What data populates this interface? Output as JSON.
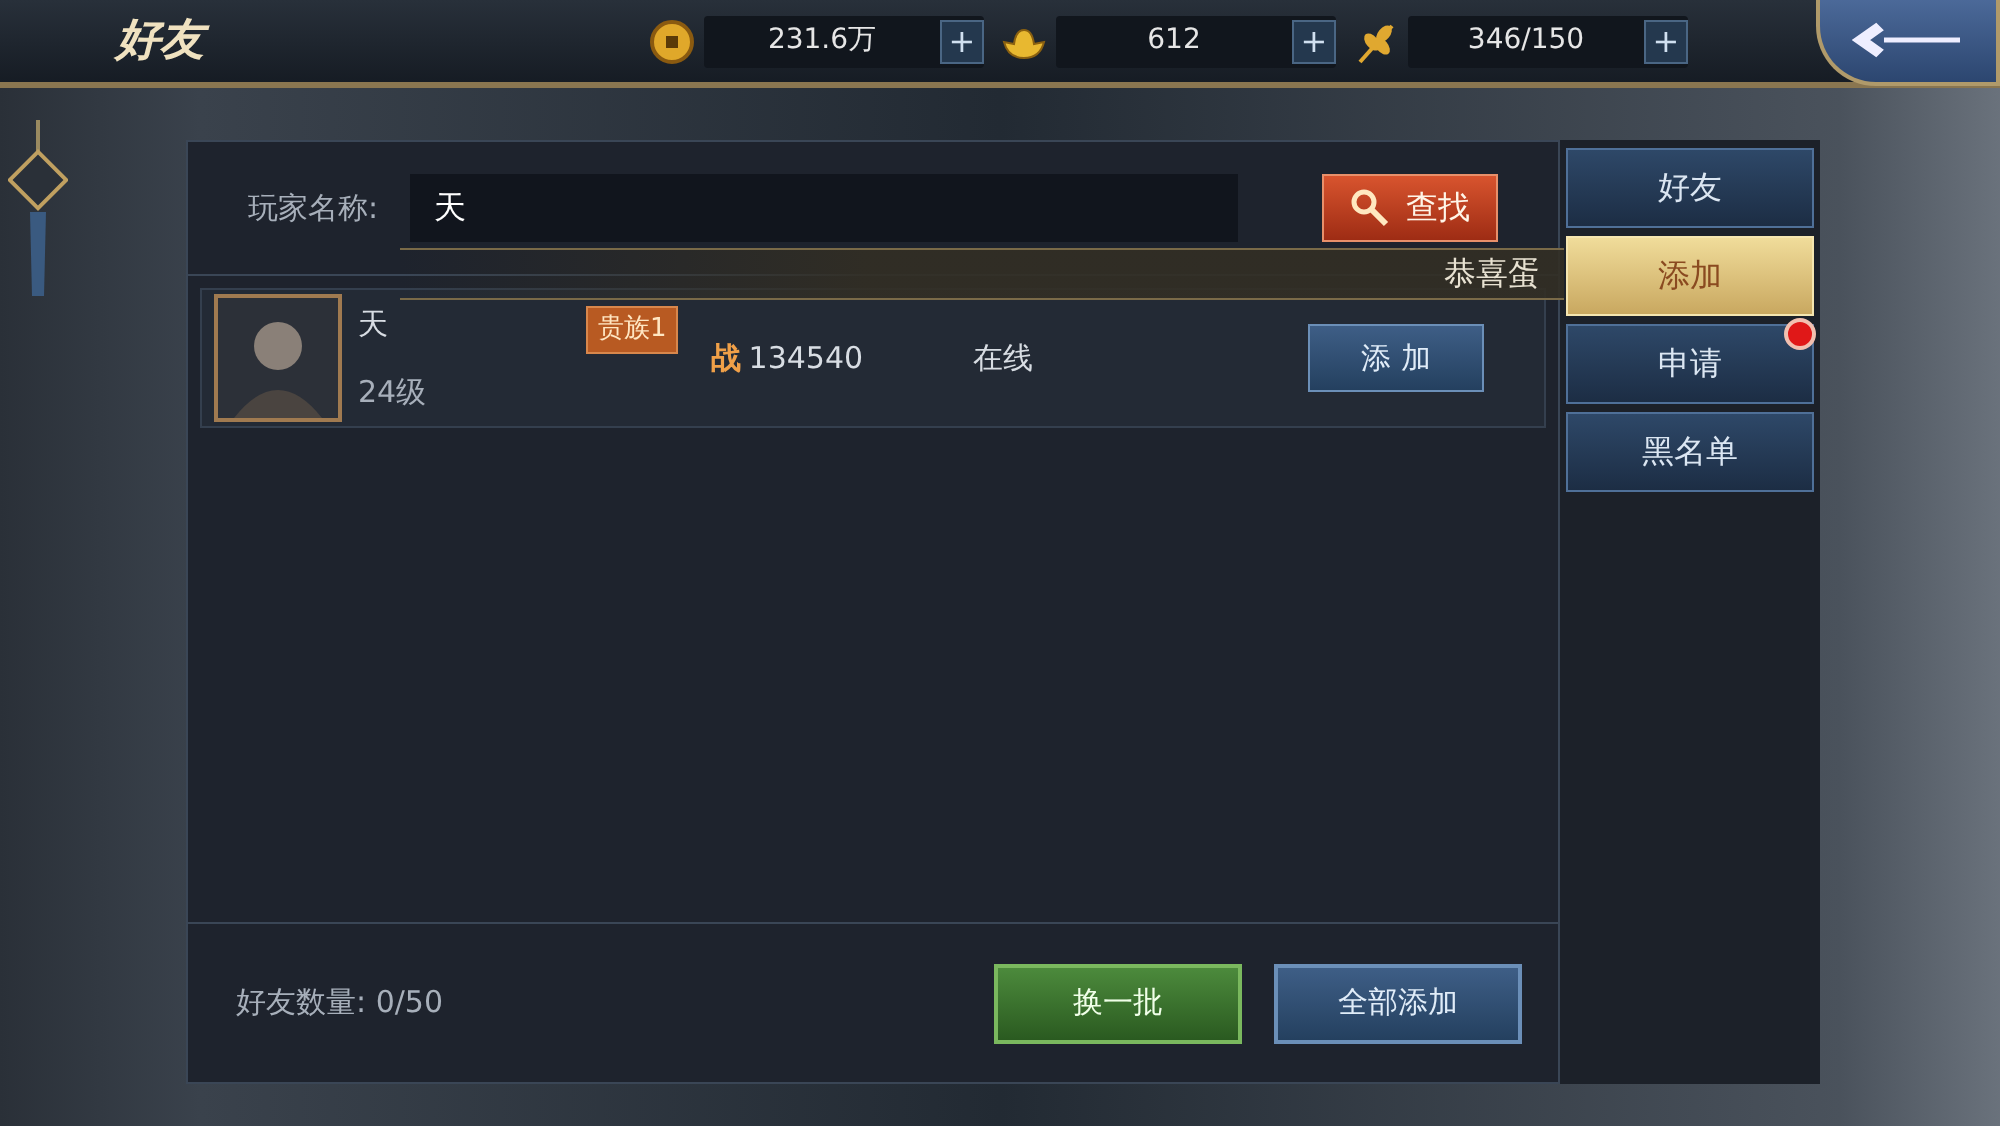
{
  "title": "好友",
  "currencies": [
    {
      "kind": "coin",
      "value": "231.6万",
      "plus": "+"
    },
    {
      "kind": "ingot",
      "value": "612",
      "plus": "+"
    },
    {
      "kind": "grain",
      "value": "346/150",
      "plus": "+"
    }
  ],
  "search": {
    "label": "玩家名称:",
    "value": "天",
    "button": "查找"
  },
  "notice": "恭喜蛋",
  "players": [
    {
      "name": "天",
      "level": "24级",
      "rank": "贵族1",
      "power_mark": "战",
      "power": "134540",
      "status": "在线",
      "action": "添 加"
    }
  ],
  "footer": {
    "count": "好友数量: 0/50",
    "buttons": [
      {
        "label": "换一批",
        "kind": "green"
      },
      {
        "label": "全部添加",
        "kind": "blue"
      }
    ]
  },
  "tabs": [
    {
      "label": "好友",
      "selected": false,
      "badge": false
    },
    {
      "label": "添加",
      "selected": true,
      "badge": false
    },
    {
      "label": "申请",
      "selected": false,
      "badge": true
    },
    {
      "label": "黑名单",
      "selected": false,
      "badge": false
    }
  ]
}
